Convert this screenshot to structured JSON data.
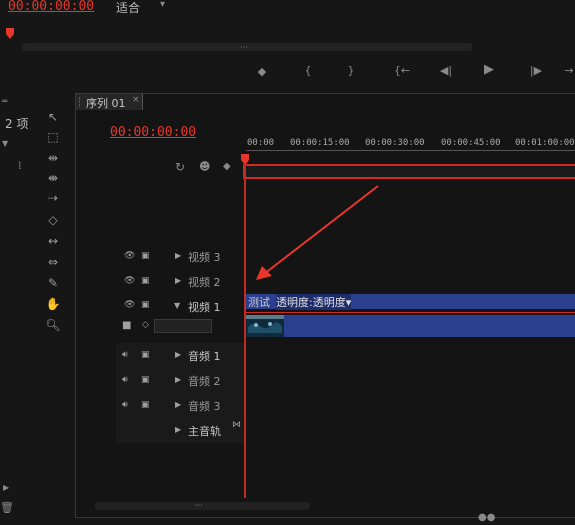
{
  "monitor": {
    "timecode": "00:00:00:00",
    "zoom": "适合",
    "zoom_arrow": "▾"
  },
  "transport": {
    "marker": "◆",
    "in_point": "{",
    "out_point": "}",
    "goto_in": "{←",
    "step_back": "◀|",
    "play": "▶",
    "step_forward": "|▶",
    "goto_out": "→"
  },
  "project_panel": {
    "item_count": "2 项"
  },
  "sequence": {
    "tab_label": "序列 01",
    "tab_close": "×",
    "timecode": "00:00:00:00",
    "ruler_ticks": [
      "00:00",
      "00:00:15:00",
      "00:00:30:00",
      "00:00:45:00",
      "00:01:00:00"
    ]
  },
  "tracks": {
    "video": [
      {
        "label": "视频 3"
      },
      {
        "label": "视频 2"
      },
      {
        "label": "视频 1"
      }
    ],
    "audio": [
      {
        "label": "音频 1"
      },
      {
        "label": "音频 2"
      },
      {
        "label": "音频 3"
      }
    ],
    "master": {
      "label": "主音轨"
    }
  },
  "clip": {
    "name": "测试",
    "effect": "透明度:透明度▾"
  },
  "colors": {
    "accent_red": "#e8372a",
    "clip_blue": "#2b3f8f",
    "background": "#161616"
  }
}
